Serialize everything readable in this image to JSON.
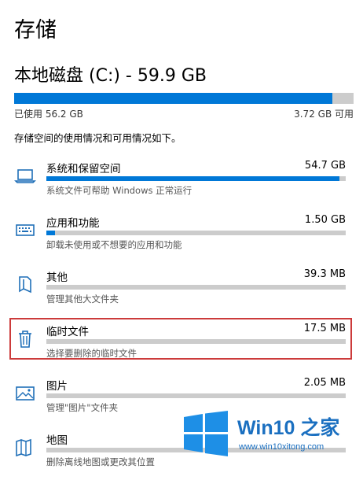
{
  "page": {
    "title": "存储",
    "drive_title": "本地磁盘 (C:) - 59.9 GB",
    "used_label": "已使用 56.2 GB",
    "free_label": "3.72 GB 可用",
    "used_fraction": 0.938,
    "description": "存储空间的使用情况和可用情况如下。",
    "accent_color": "#0078d7",
    "highlight_color": "#cc3b3b"
  },
  "items": [
    {
      "icon": "laptop-icon",
      "label": "系统和保留空间",
      "size": "54.7 GB",
      "sub": "系统文件可帮助 Windows 正常运行",
      "fraction": 0.98
    },
    {
      "icon": "keyboard-icon",
      "label": "应用和功能",
      "size": "1.50 GB",
      "sub": "卸载未使用或不想要的应用和功能",
      "fraction": 0.03
    },
    {
      "icon": "document-icon",
      "label": "其他",
      "size": "39.3 MB",
      "sub": "管理其他大文件夹",
      "fraction": 0.0
    },
    {
      "icon": "trash-icon",
      "label": "临时文件",
      "size": "17.5 MB",
      "sub": "选择要删除的临时文件",
      "fraction": 0.0
    },
    {
      "icon": "picture-icon",
      "label": "图片",
      "size": "2.05 MB",
      "sub": "管理\"图片\"文件夹",
      "fraction": 0.0
    },
    {
      "icon": "map-icon",
      "label": "地图",
      "size": "",
      "sub": "删除离线地图或更改其位置",
      "fraction": 0.0
    }
  ],
  "watermark": {
    "title": "Win10 之家",
    "url": "www.win10xitong.com"
  }
}
